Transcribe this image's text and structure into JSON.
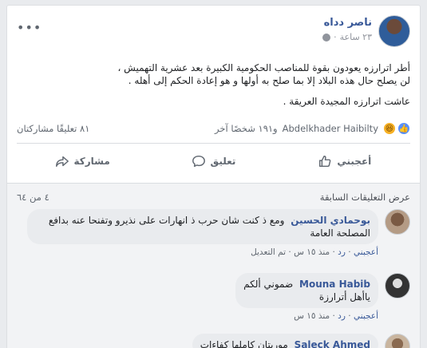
{
  "post": {
    "author": "ناصر دداه",
    "time": "٢٣ ساعة",
    "more_icon": "ellipsis-icon",
    "lines": [
      "أطر اترارزه يعودون بقوة للمناصب الحكومية الكبيرة بعد عشرية التهميش ،",
      "لن يصلح حال هذه البلاد إلا بما صلح به أولها و هو إعادة الحكم إلى أهله ."
    ],
    "closing": "عاشت اترارزه المجيدة العريقة ."
  },
  "stats": {
    "reactors_name": "Abdelkhader Haibilty",
    "reactors_others": "و١٩١ شخصًا آخر",
    "comments_shares": "٨١ تعليقًا مشاركتان"
  },
  "actions": {
    "like": "أعجبني",
    "comment": "تعليق",
    "share": "مشاركة"
  },
  "comments_header": {
    "view_previous": "عرض التعليقات السابقة",
    "count": "٤ من ٦٤"
  },
  "comments": [
    {
      "name": "بوحمادي الحسين",
      "text": "ومع ذ كنت شان حرب ذ انهارات على نذيرو وتفنحا عنه بدافع المصلحة العامة",
      "like": "أعجبني",
      "reply": "رد",
      "time": "منذ ١٥ س",
      "edited": "تم التعديل"
    },
    {
      "name": "Mouna Habib",
      "text_line1": "ضموني ألكم",
      "text_line2": "ياأهل أترارزة",
      "like": "أعجبني",
      "reply": "رد",
      "time": "منذ ١٥ س"
    },
    {
      "name": "Saleck Ahmed",
      "text": "موريتان كاملها كفاءات"
    }
  ]
}
